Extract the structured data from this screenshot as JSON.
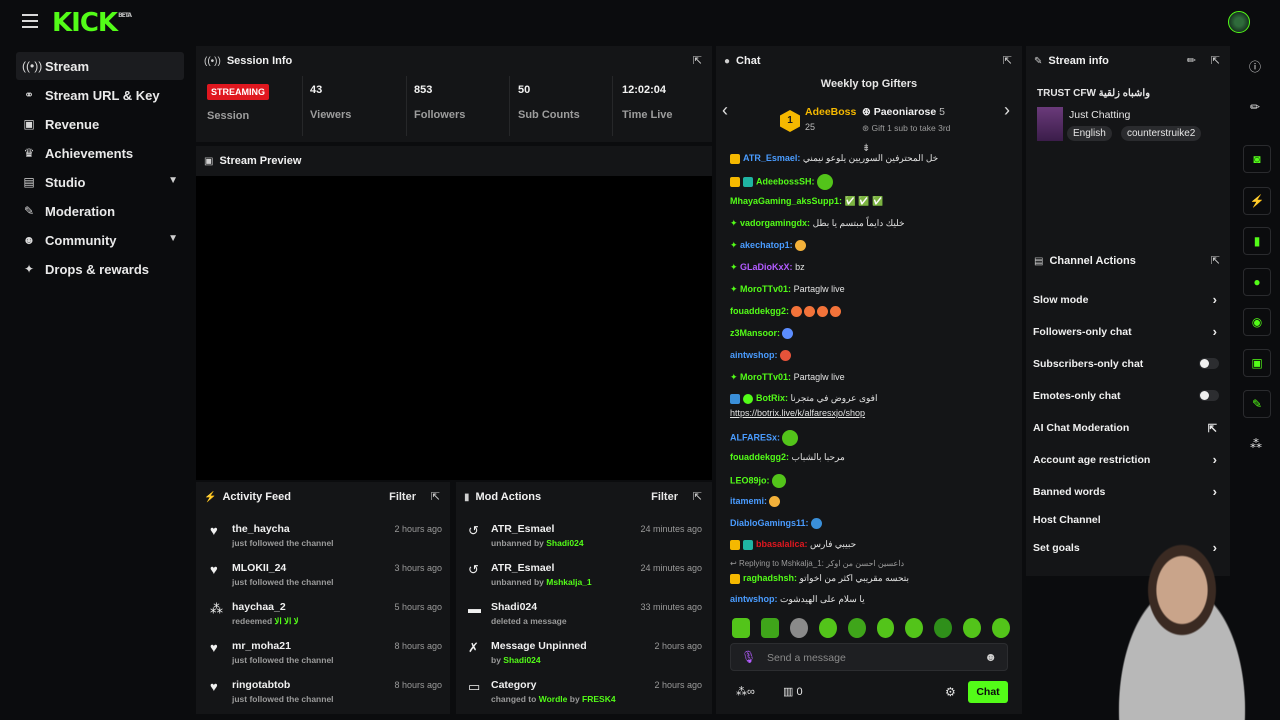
{
  "brand": {
    "logo": "KICK",
    "tag": "BETA",
    "accent": "#53fc18"
  },
  "sidebar": {
    "items": [
      {
        "label": "Stream",
        "icon": "broadcast-icon"
      },
      {
        "label": "Stream URL & Key",
        "icon": "link-icon"
      },
      {
        "label": "Revenue",
        "icon": "revenue-icon"
      },
      {
        "label": "Achievements",
        "icon": "trophy-icon"
      },
      {
        "label": "Studio",
        "icon": "studio-icon"
      },
      {
        "label": "Moderation",
        "icon": "wrench-icon"
      },
      {
        "label": "Community",
        "icon": "community-icon"
      },
      {
        "label": "Drops & rewards",
        "icon": "gift-icon"
      }
    ]
  },
  "session": {
    "title": "Session Info",
    "status": "STREAMING",
    "status_label": "Session",
    "stats": [
      {
        "value": "43",
        "label": "Viewers"
      },
      {
        "value": "853",
        "label": "Followers"
      },
      {
        "value": "50",
        "label": "Sub Counts"
      },
      {
        "value": "12:02:04",
        "label": "Time Live"
      }
    ]
  },
  "preview": {
    "title": "Stream Preview"
  },
  "activity": {
    "title": "Activity Feed",
    "filter": "Filter",
    "rows": [
      {
        "name": "the_haycha",
        "sub": "just followed the channel",
        "time": "2 hours ago",
        "icon": "heart-icon"
      },
      {
        "name": "MLOKII_24",
        "sub": "just followed the channel",
        "time": "3 hours ago",
        "icon": "heart-icon"
      },
      {
        "name": "haychaa_2",
        "sub": "redeemed",
        "extra": "لا الا الا",
        "time": "5 hours ago",
        "icon": "points-icon"
      },
      {
        "name": "mr_moha21",
        "sub": "just followed the channel",
        "time": "8 hours ago",
        "icon": "heart-icon"
      },
      {
        "name": "ringotabtob",
        "sub": "just followed the channel",
        "time": "8 hours ago",
        "icon": "heart-icon"
      }
    ]
  },
  "mod": {
    "title": "Mod Actions",
    "filter": "Filter",
    "rows": [
      {
        "name": "ATR_Esmael",
        "sub": "unbanned by",
        "by": "Shadi024",
        "time": "24 minutes ago",
        "icon": "undo-icon"
      },
      {
        "name": "ATR_Esmael",
        "sub": "unbanned by",
        "by": "Mshkalja_1",
        "time": "24 minutes ago",
        "icon": "undo-icon"
      },
      {
        "name": "Shadi024",
        "sub": "deleted a message",
        "by": "",
        "time": "33 minutes ago",
        "icon": "trash-icon"
      },
      {
        "name": "Message Unpinned",
        "sub": "by",
        "by": "Shadi024",
        "time": "2 hours ago",
        "icon": "unpin-icon"
      },
      {
        "name": "Category",
        "sub": "changed to",
        "by": "Wordle",
        "sub2": "by",
        "by2": "FRESK4",
        "time": "2 hours ago",
        "icon": "category-icon"
      }
    ]
  },
  "chat": {
    "title": "Chat",
    "gifters_title": "Weekly top Gifters",
    "gifter1": {
      "name": "AdeeBoss",
      "count": "25",
      "rank": "1"
    },
    "gifter2": {
      "name": "Paeoniarose",
      "count": "5",
      "note": "Gift 1 sub to take 3rd"
    },
    "messages": [
      {
        "user": "ATR_Esmael:",
        "color": "#4a9cff",
        "text": "خل المحترفين السوريين يلوعو نيمني"
      },
      {
        "user": "AdeebossSH:",
        "color": "#53fc18",
        "text": ""
      },
      {
        "user": "MhayaGaming_aksSupp1:",
        "color": "#53fc18",
        "text": "✅ ✅ ✅"
      },
      {
        "user": "vadorgamingdx:",
        "color": "#53fc18",
        "text": "خليك دايماً مبتسم يا بطل"
      },
      {
        "user": "akechatop1:",
        "color": "#4a9cff",
        "text": ""
      },
      {
        "user": "GLaDioKxX:",
        "color": "#b35cff",
        "text": "bz"
      },
      {
        "user": "MoroTTv01:",
        "color": "#53fc18",
        "text": "Partaglw live"
      },
      {
        "user": "fouaddekgg2:",
        "color": "#53fc18",
        "text": ""
      },
      {
        "user": "z3Mansoor:",
        "color": "#53fc18",
        "text": ""
      },
      {
        "user": "aintwshop:",
        "color": "#4a9cff",
        "text": ""
      },
      {
        "user": "MoroTTv01:",
        "color": "#53fc18",
        "text": "Partaglw live"
      },
      {
        "user": "BotRix:",
        "color": "#53fc18",
        "text": "افوى عروض في متجرنا"
      },
      {
        "user": "",
        "color": "#e2e2e2",
        "text": "https://botrix.live/k/alfaresxjo/shop"
      },
      {
        "user": "ALFARESx:",
        "color": "#4a9cff",
        "text": ""
      },
      {
        "user": "fouaddekgg2:",
        "color": "#53fc18",
        "text": "مرحبا بالشباب"
      },
      {
        "user": "LEO89jo:",
        "color": "#53fc18",
        "text": ""
      },
      {
        "user": "itamemi:",
        "color": "#4a9cff",
        "text": ""
      },
      {
        "user": "DiabloGamings11:",
        "color": "#4a9cff",
        "text": ""
      },
      {
        "user": "bbasalalica:",
        "color": "#e0171f",
        "text": "حبيبي فارس"
      },
      {
        "user": "Replying to Mshkalja_1:",
        "color": "#9a9a9a",
        "text": "داعسين احسن من اوكر"
      },
      {
        "user": "raghadshsh:",
        "color": "#53fc18",
        "text": "بتحسه مقريبي اكثر من اخواتو"
      },
      {
        "user": "aintwshop:",
        "color": "#4a9cff",
        "text": "يا سلام على الهيدشوت"
      }
    ],
    "input_placeholder": "Send a message",
    "points": "0",
    "send_label": "Chat"
  },
  "streaminfo": {
    "title": "Stream info",
    "stream_title": "TRUST CFW واشباه زلقية",
    "category": "Just Chatting",
    "tags": [
      "English",
      "counterstruike2"
    ]
  },
  "actions": {
    "title": "Channel Actions",
    "items": [
      {
        "label": "Slow mode",
        "kind": "arrow"
      },
      {
        "label": "Followers-only chat",
        "kind": "arrow"
      },
      {
        "label": "Subscribers-only chat",
        "kind": "toggle"
      },
      {
        "label": "Emotes-only chat",
        "kind": "toggle"
      },
      {
        "label": "AI Chat Moderation",
        "kind": "external"
      },
      {
        "label": "Account age restriction",
        "kind": "arrow"
      },
      {
        "label": "Banned words",
        "kind": "arrow"
      },
      {
        "label": "Host Channel",
        "kind": "none"
      },
      {
        "label": "Set goals",
        "kind": "arrow"
      }
    ]
  }
}
